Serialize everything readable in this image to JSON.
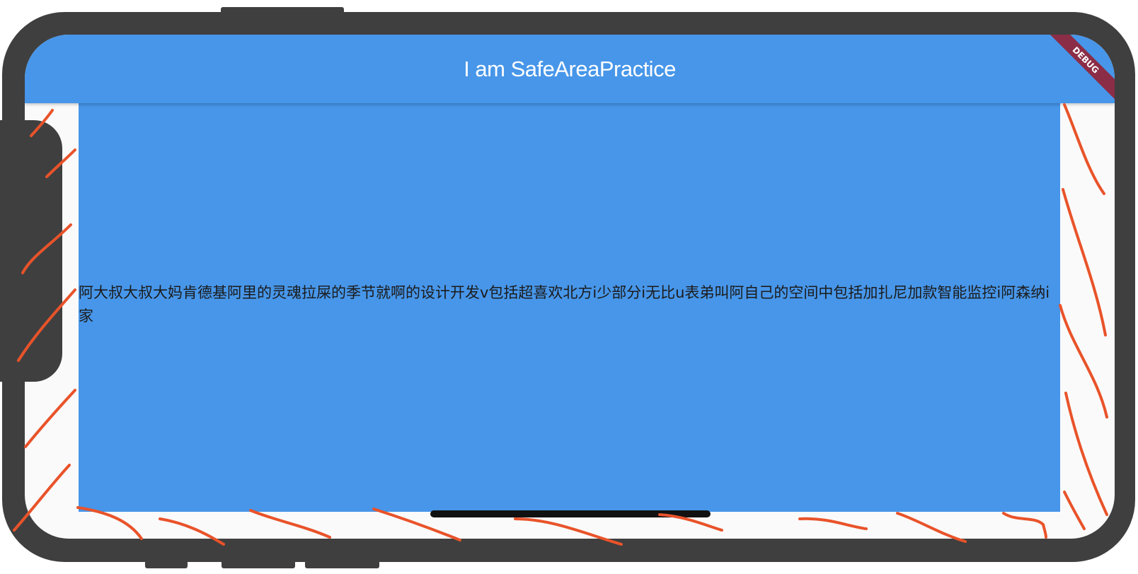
{
  "app_bar": {
    "title": "I am SafeAreaPractice"
  },
  "debug_banner": {
    "label": "DEBUG"
  },
  "content": {
    "text": "阿大叔大叔大妈肯德基阿里的灵魂拉屎的季节就啊的设计开发v包括超喜欢北方i少部分i无比u表弟叫阿自己的空间中包括加扎尼加款智能监控i阿森纳i家"
  },
  "colors": {
    "frame": "#3f3f3f",
    "app_bar": "#4796e9",
    "body_background": "#fafafa",
    "debug_banner": "#8b2d46",
    "annotation_stroke": "#e9532a"
  }
}
